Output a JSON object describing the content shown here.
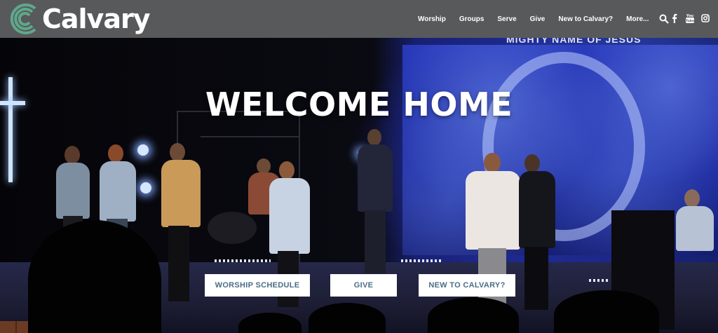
{
  "brand": {
    "name": "Calvary",
    "logo_color": "#5fa88c"
  },
  "nav": {
    "items": [
      "Worship",
      "Groups",
      "Serve",
      "Give",
      "New to Calvary?",
      "More..."
    ],
    "search_icon": "search-icon"
  },
  "social": {
    "icons": [
      "facebook-icon",
      "youtube-icon",
      "instagram-icon"
    ]
  },
  "hero": {
    "headline": "WELCOME HOME",
    "screen_text": "MIGHTY NAME OF JESUS",
    "buttons": [
      "WORSHIP SCHEDULE",
      "GIVE",
      "NEW TO CALVARY?"
    ]
  },
  "colors": {
    "header_bg": "#58595b",
    "button_text": "#4a6d86",
    "button_bg": "#ffffff",
    "screen_blue": "#1e2c95"
  }
}
